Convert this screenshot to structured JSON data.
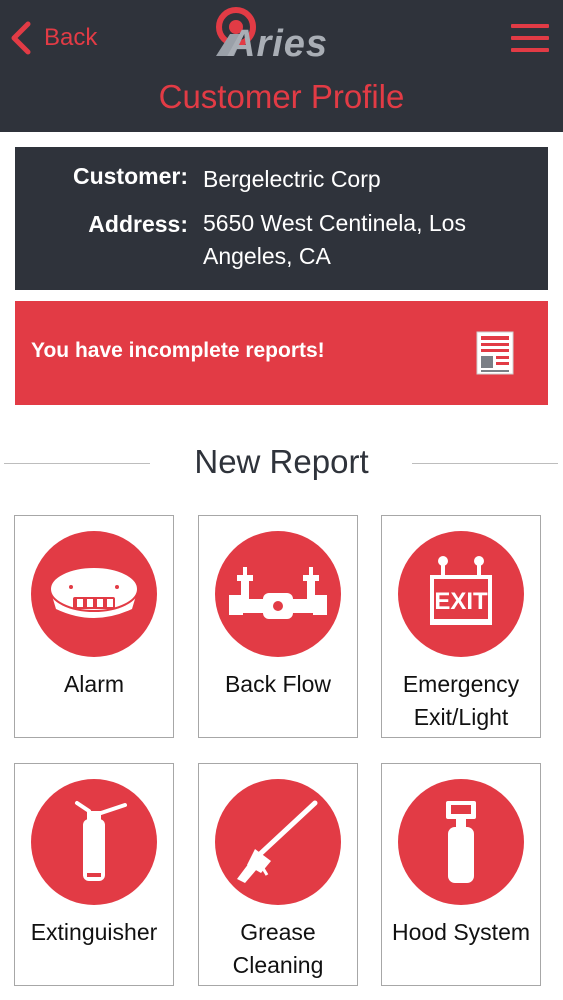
{
  "header": {
    "back_label": "Back",
    "logo_text": "Aries",
    "title": "Customer Profile"
  },
  "customer": {
    "customer_label": "Customer:",
    "customer_value": "Bergelectric Corp",
    "address_label": "Address:",
    "address_value": "5650 West Centinela, Los Angeles, CA"
  },
  "alert": {
    "text": "You have incomplete reports!",
    "icon": "report-document-icon"
  },
  "new_report": {
    "title": "New Report",
    "tiles": [
      {
        "label": "Alarm",
        "icon": "smoke-detector-icon"
      },
      {
        "label": "Back Flow",
        "icon": "backflow-valve-icon"
      },
      {
        "label": "Emergency Exit/Light",
        "icon": "exit-sign-icon"
      },
      {
        "label": "Extinguisher",
        "icon": "fire-extinguisher-icon"
      },
      {
        "label": "Grease Cleaning",
        "icon": "pressure-washer-icon"
      },
      {
        "label": "Hood System",
        "icon": "hood-cylinder-icon"
      }
    ],
    "exit_sign_text": "EXIT"
  },
  "colors": {
    "accent": "#e23b45",
    "dark": "#2f333b",
    "text": "#111111",
    "border": "#a7a7a7"
  }
}
